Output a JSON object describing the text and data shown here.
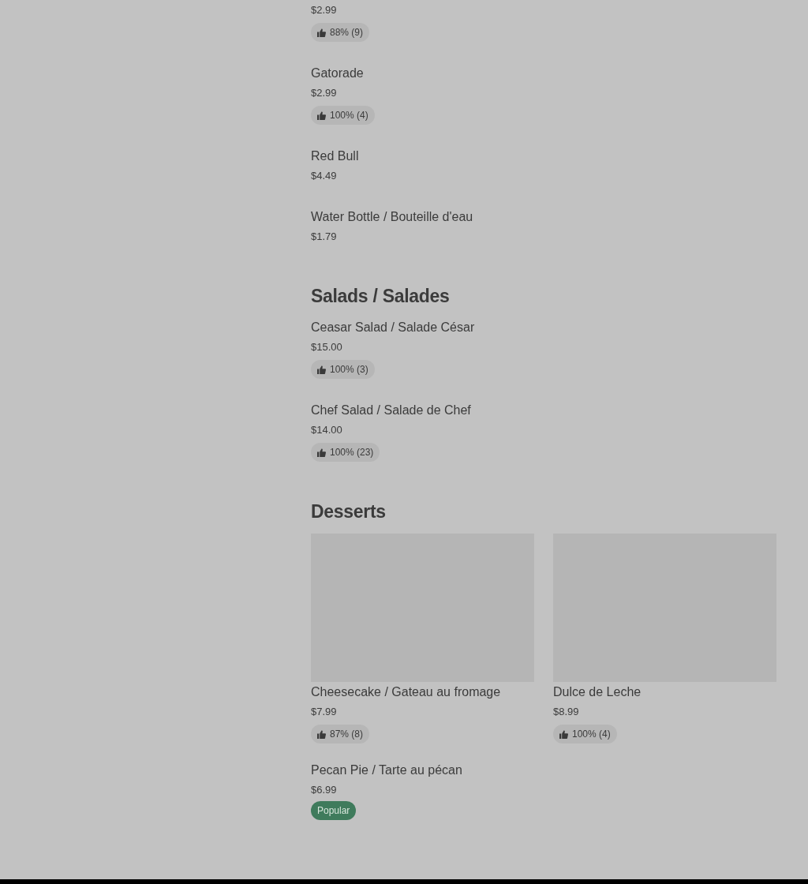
{
  "sections": [
    {
      "kind": "list",
      "items": [
        {
          "price": "$2.99",
          "rating": "88% (9)"
        },
        {
          "name": "Gatorade",
          "price": "$2.99",
          "rating": "100% (4)"
        },
        {
          "name": "Red Bull",
          "price": "$4.49"
        },
        {
          "name": "Water Bottle / Bouteille d'eau",
          "price": "$1.79"
        }
      ]
    },
    {
      "kind": "list",
      "title": "Salads / Salades",
      "items": [
        {
          "name": "Ceasar Salad / Salade César",
          "price": "$15.00",
          "rating": "100% (3)"
        },
        {
          "name": "Chef Salad / Salade de Chef",
          "price": "$14.00",
          "rating": "100% (23)"
        }
      ]
    },
    {
      "kind": "grid",
      "title": "Desserts",
      "items": [
        {
          "name": "Cheesecake / Gateau au fromage",
          "price": "$7.99",
          "rating": "87% (8)",
          "image": {
            "kind": "placeholder"
          }
        },
        {
          "name": "Dulce de Leche",
          "price": "$8.99",
          "rating": "100% (4)",
          "image": {
            "kind": "placeholder"
          }
        },
        {
          "name": "Pecan Pie / Tarte au pécan",
          "price": "$6.99",
          "badge": "Popular"
        }
      ]
    }
  ]
}
